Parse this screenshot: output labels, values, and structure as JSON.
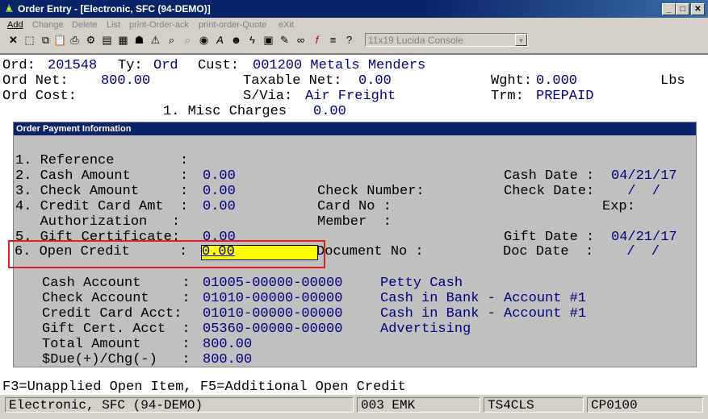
{
  "window": {
    "title": "Order Entry - [Electronic, SFC (94-DEMO)]"
  },
  "menu": [
    {
      "label": "Add",
      "enabled": true
    },
    {
      "label": "Change",
      "enabled": false
    },
    {
      "label": "Delete",
      "enabled": false
    },
    {
      "label": "List",
      "enabled": false
    },
    {
      "label": "print-Order-ack",
      "enabled": false
    },
    {
      "label": "print-order-Quote",
      "enabled": false
    },
    {
      "label": "eXit",
      "enabled": false
    }
  ],
  "toolbar": {
    "font_select": "11x19 Lucida Console"
  },
  "header": {
    "ord_label": "Ord:",
    "ord_value": "201548",
    "ty_label": "Ty:",
    "ty_value": "Ord",
    "cust_label": "Cust:",
    "cust_value": "001200 Metals Menders",
    "ord_net_label": "Ord Net:",
    "ord_net_value": "800.00",
    "taxable_label": "Taxable Net:",
    "taxable_value": "0.00",
    "wght_label": "Wght:",
    "wght_value": "0.000",
    "wght_unit": "Lbs",
    "ord_cost_label": "Ord Cost:",
    "svia_label": "S/Via:",
    "svia_value": "Air Freight",
    "trm_label": "Trm:",
    "trm_value": "PREPAID",
    "misc_label": "1. Misc Charges",
    "misc_value": "0.00"
  },
  "dialog": {
    "title": "Order Payment Information",
    "lines": {
      "reference": "1. Reference        :",
      "cash_amount_label": "2. Cash Amount      :",
      "cash_amount_value": "0.00",
      "check_amount_label": "3. Check Amount     :",
      "check_amount_value": "0.00",
      "credit_label": "4. Credit Card Amt  :",
      "credit_value": "0.00",
      "authorization": "   Authorization   :",
      "gift_label": "5. Gift Certificate:",
      "gift_value": "0.00",
      "open_label": "6. Open Credit      :",
      "open_value": "0.00"
    },
    "mid": {
      "check_number": "Check Number:",
      "card_no": "Card No :",
      "member": "Member  :",
      "document_no": "Document No :"
    },
    "right": {
      "cash_date_label": "Cash Date :",
      "cash_date_value": "04/21/17",
      "check_date_label": "Check Date:",
      "check_date_value": " /  /",
      "exp_label": "Exp:",
      "gift_date_label": "Gift Date :",
      "gift_date_value": "04/21/17",
      "doc_date_label": "Doc Date  :",
      "doc_date_value": " /  /"
    },
    "accounts": [
      {
        "label": "Cash Account     :",
        "number": "01005-00000-00000",
        "name": "Petty Cash"
      },
      {
        "label": "Check Account    :",
        "number": "01010-00000-00000",
        "name": "Cash in Bank - Account #1"
      },
      {
        "label": "Credit Card Acct:",
        "number": "01010-00000-00000",
        "name": "Cash in Bank - Account #1"
      },
      {
        "label": "Gift Cert. Acct  :",
        "number": "05360-00000-00000",
        "name": "Advertising"
      }
    ],
    "total_label": "Total Amount     :",
    "total_value": "800.00",
    "due_label": "$Due(+)/Chg(-)   :",
    "due_value": "800.00"
  },
  "hint": "F3=Unapplied Open Item, F5=Additional Open Credit",
  "status": {
    "company": "Electronic, SFC (94-DEMO)",
    "user": "003 EMK",
    "terminal": "TS4CLS",
    "program": "CP0100"
  }
}
